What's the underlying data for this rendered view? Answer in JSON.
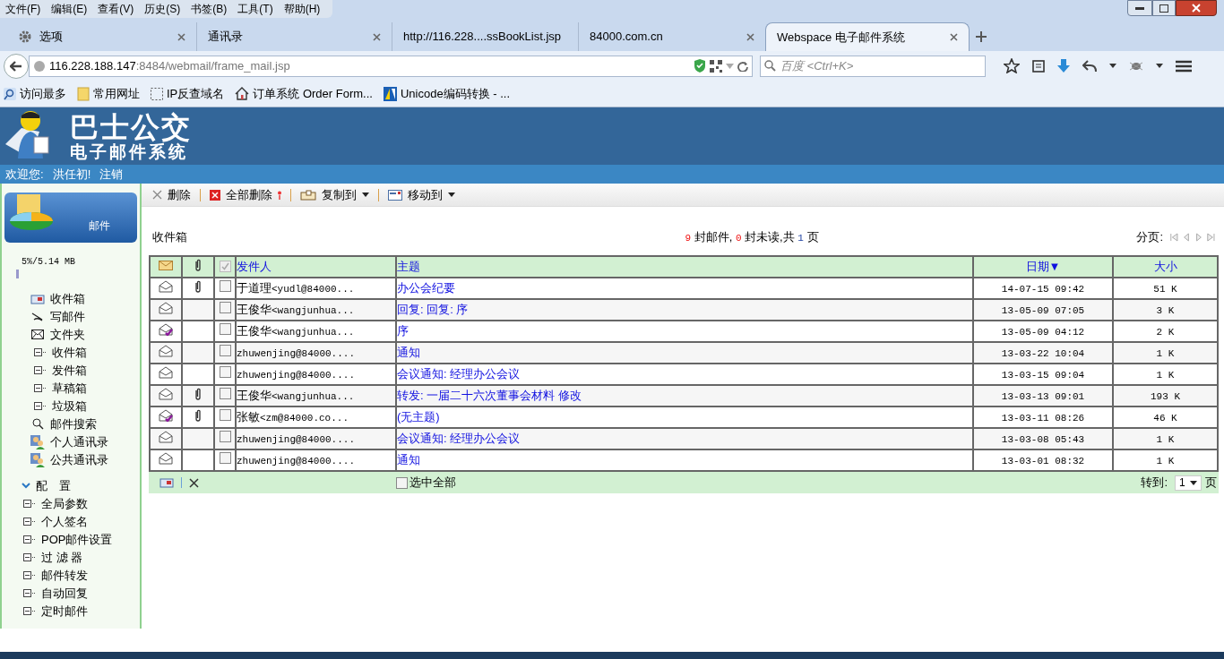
{
  "menu_bar": [
    "文件(F)",
    "编辑(E)",
    "查看(V)",
    "历史(S)",
    "书签(B)",
    "工具(T)",
    "帮助(H)"
  ],
  "tabs": [
    {
      "label": "选项",
      "kind": "gear",
      "selected": false
    },
    {
      "label": "通讯录",
      "kind": "page",
      "selected": false
    },
    {
      "label": "http://116.228....ssBookList.jsp",
      "kind": "page",
      "selected": false
    },
    {
      "label": "84000.com.cn",
      "kind": "page",
      "selected": false
    },
    {
      "label": "Webspace 电子邮件系统",
      "kind": "page",
      "selected": true
    }
  ],
  "address": {
    "host": "116.228.188.147",
    "rest": ":8484/webmail/frame_mail.jsp"
  },
  "search": {
    "placeholder": "百度 <Ctrl+K>"
  },
  "bookmarks": [
    {
      "label": "访问最多",
      "kind": "search"
    },
    {
      "label": "常用网址",
      "kind": "folder"
    },
    {
      "label": "IP反查域名",
      "kind": "dashed"
    },
    {
      "label": "订单系统 Order Form...",
      "kind": "home"
    },
    {
      "label": "Unicode编码转换 - ...",
      "kind": "logo"
    }
  ],
  "banner": {
    "line1": "巴士公交",
    "line2": "电子邮件系统"
  },
  "welcome": {
    "greeting": "欢迎您:",
    "user": "洪任初!",
    "logout": "注销"
  },
  "sidebar": {
    "section": "邮件",
    "quota": "5%/5.14 MB",
    "items": [
      {
        "label": "收件箱",
        "kind": "inbox"
      },
      {
        "label": "写邮件",
        "kind": "compose"
      },
      {
        "label": "文件夹",
        "kind": "folder",
        "children": [
          {
            "label": "收件箱"
          },
          {
            "label": "发件箱"
          },
          {
            "label": "草稿箱"
          },
          {
            "label": "垃圾箱"
          }
        ]
      },
      {
        "label": "邮件搜索",
        "kind": "search"
      },
      {
        "label": "个人通讯录",
        "kind": "contacts"
      },
      {
        "label": "公共通讯录",
        "kind": "contacts"
      }
    ],
    "config": {
      "label": "配　置",
      "expanded": true,
      "items": [
        "全局参数",
        "个人签名",
        "POP邮件设置",
        "过 滤 器",
        "邮件转发",
        "自动回复",
        "定时邮件"
      ]
    }
  },
  "toolbar": [
    {
      "label": "删除",
      "kind": "delete",
      "dropdown": false
    },
    {
      "label": "全部删除",
      "kind": "delete_all",
      "dropdown": false
    },
    {
      "label": "复制到",
      "kind": "copy",
      "dropdown": true
    },
    {
      "label": "移动到",
      "kind": "move",
      "dropdown": true
    }
  ],
  "folder_title": "收件箱",
  "summary": {
    "total": "9",
    "total_label": "封邮件,",
    "unread": "0",
    "unread_label": "封未读,共",
    "pages": "1",
    "pages_label": "页"
  },
  "pager_label": "分页:",
  "table": {
    "columns": [
      "发件人",
      "主题",
      "日期▼",
      "大小"
    ],
    "header_checked": true,
    "rows": [
      {
        "replied": false,
        "attachment": true,
        "checked": false,
        "sender_name": "于道理",
        "sender_addr": "<yudl@84000...",
        "subject": "办公会纪要",
        "date": "14-07-15 09:42",
        "size": "51 K"
      },
      {
        "replied": false,
        "attachment": false,
        "checked": false,
        "sender_name": "王俊华",
        "sender_addr": "<wangjunhua...",
        "subject": "回复: 回复: 序",
        "date": "13-05-09 07:05",
        "size": "3 K"
      },
      {
        "replied": true,
        "attachment": false,
        "checked": false,
        "sender_name": "王俊华",
        "sender_addr": "<wangjunhua...",
        "subject": "序",
        "date": "13-05-09 04:12",
        "size": "2 K"
      },
      {
        "replied": false,
        "attachment": false,
        "checked": false,
        "sender_name": "",
        "sender_addr": "zhuwenjing@84000....",
        "subject": "通知",
        "date": "13-03-22 10:04",
        "size": "1 K"
      },
      {
        "replied": false,
        "attachment": false,
        "checked": false,
        "sender_name": "",
        "sender_addr": "zhuwenjing@84000....",
        "subject": "会议通知: 经理办公会议",
        "date": "13-03-15 09:04",
        "size": "1 K"
      },
      {
        "replied": false,
        "attachment": true,
        "checked": false,
        "sender_name": "王俊华",
        "sender_addr": "<wangjunhua...",
        "subject": "转发: 一届二十六次董事会材料 修改",
        "date": "13-03-13 09:01",
        "size": "193 K"
      },
      {
        "replied": true,
        "attachment": true,
        "checked": false,
        "sender_name": "张敏",
        "sender_addr": "<zm@84000.co...",
        "subject": "(无主题)",
        "date": "13-03-11 08:26",
        "size": "46 K"
      },
      {
        "replied": false,
        "attachment": false,
        "checked": false,
        "sender_name": "",
        "sender_addr": "zhuwenjing@84000....",
        "subject": "会议通知: 经理办公会议",
        "date": "13-03-08 05:43",
        "size": "1 K"
      },
      {
        "replied": false,
        "attachment": false,
        "checked": false,
        "sender_name": "",
        "sender_addr": "zhuwenjing@84000....",
        "subject": "通知",
        "date": "13-03-01 08:32",
        "size": "1 K"
      }
    ]
  },
  "footer": {
    "select_all": "选中全部",
    "select_all_checked": false,
    "goto_label": "转到:",
    "page": "1",
    "page_suffix": "页"
  }
}
